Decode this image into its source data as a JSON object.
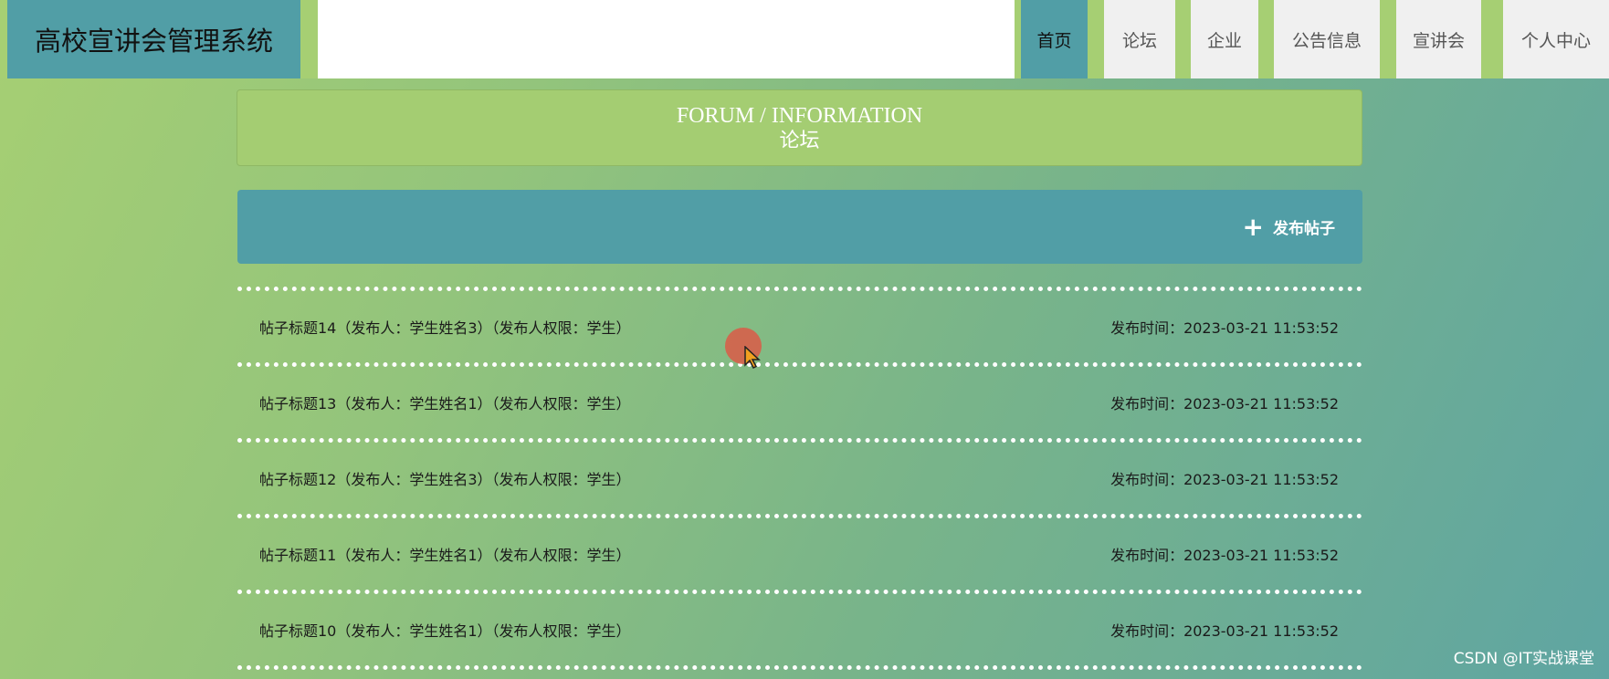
{
  "header": {
    "app_title": "高校宣讲会管理系统",
    "nav": [
      {
        "label": "首页",
        "active": true
      },
      {
        "label": "论坛",
        "active": false
      },
      {
        "label": "企业",
        "active": false
      },
      {
        "label": "公告信息",
        "active": false
      },
      {
        "label": "宣讲会",
        "active": false
      },
      {
        "label": "个人中心",
        "active": false
      }
    ]
  },
  "banner": {
    "title_en": "FORUM / INFORMATION",
    "title_cn": "论坛"
  },
  "toolbar": {
    "post_button_label": "发布帖子",
    "post_button_icon": "plus-icon"
  },
  "posts": [
    {
      "title": "帖子标题14（发布人：学生姓名3）（发布人权限：学生）",
      "time": "发布时间：2023-03-21 11:53:52"
    },
    {
      "title": "帖子标题13（发布人：学生姓名1）（发布人权限：学生）",
      "time": "发布时间：2023-03-21 11:53:52"
    },
    {
      "title": "帖子标题12（发布人：学生姓名3）（发布人权限：学生）",
      "time": "发布时间：2023-03-21 11:53:52"
    },
    {
      "title": "帖子标题11（发布人：学生姓名1）（发布人权限：学生）",
      "time": "发布时间：2023-03-21 11:53:52"
    },
    {
      "title": "帖子标题10（发布人：学生姓名1）（发布人权限：学生）",
      "time": "发布时间：2023-03-21 11:53:52"
    }
  ],
  "watermark": "CSDN @IT实战课堂",
  "colors": {
    "accent": "#519ea6",
    "header_bg": "#a6cf73",
    "banner_bg": "#a4cd72"
  }
}
